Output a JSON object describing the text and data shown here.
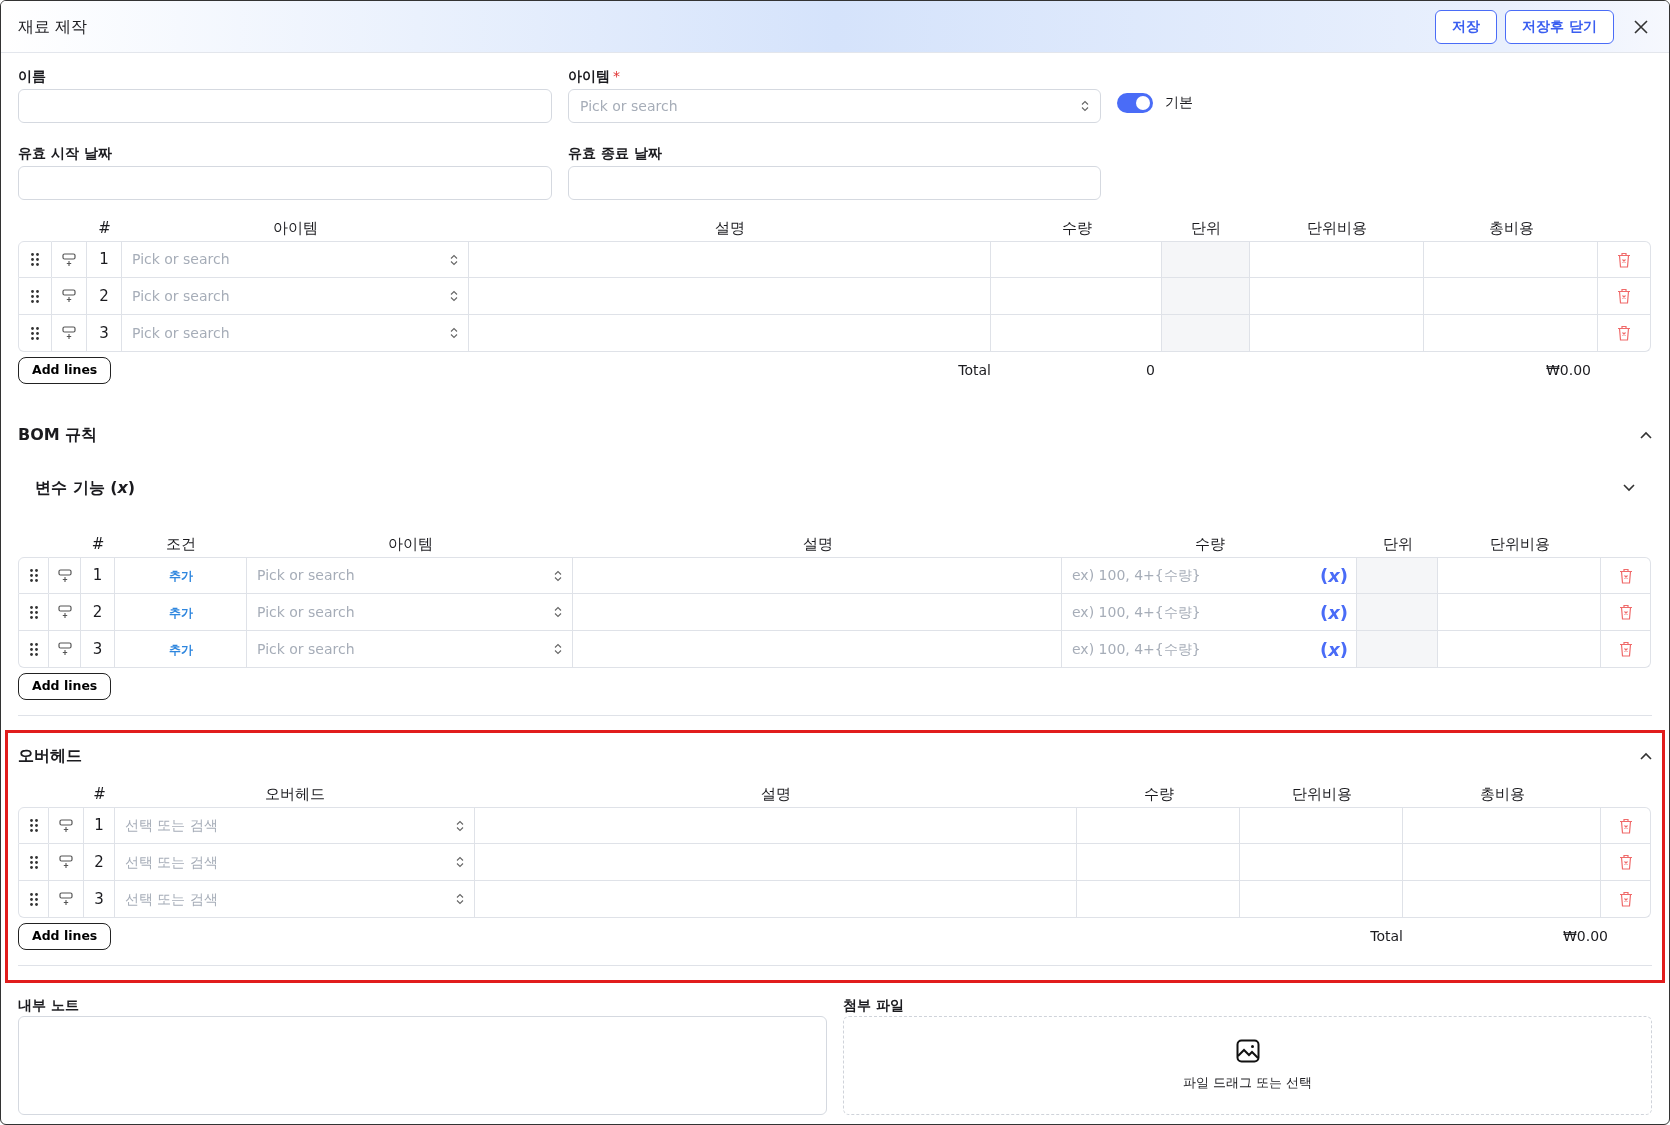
{
  "header": {
    "title": "재료 제작",
    "buttons": [
      "저장",
      "저장후 닫기"
    ]
  },
  "fields": [
    {
      "label": "이름",
      "kind": "text"
    },
    {
      "label": "아이템",
      "required_mark": "*",
      "kind": "select",
      "placeholder": "Pick or search"
    },
    {
      "label": "유효 시작 날짜",
      "kind": "text"
    },
    {
      "label": "유효 종료 날짜",
      "kind": "text"
    }
  ],
  "default_toggle": {
    "label": "기본",
    "on": true
  },
  "materials": {
    "columns": [
      "#",
      "아이템",
      "설명",
      "수량",
      "단위",
      "단위비용",
      "총비용"
    ],
    "rows": [
      {
        "number": "1",
        "item_placeholder": "Pick or search"
      },
      {
        "number": "2",
        "item_placeholder": "Pick or search"
      },
      {
        "number": "3",
        "item_placeholder": "Pick or search"
      }
    ],
    "add_button": "Add lines",
    "total_label": "Total",
    "total_quantity": "0",
    "total_cost": "₩0.00"
  },
  "bom_rules": {
    "title": "BOM 규칙",
    "expanded": true,
    "variable_feature": {
      "title": "변수 기능 (*x*)",
      "expanded": false
    },
    "columns": [
      "#",
      "조건",
      "아이템",
      "설명",
      "수량",
      "단위",
      "단위비용"
    ],
    "rows": [
      {
        "number": "1",
        "condition": "추가",
        "item_placeholder": "Pick or search",
        "quantity_placeholder": "ex) 100, 4+{수량}",
        "variable_button": "(*x*)"
      },
      {
        "number": "2",
        "condition": "추가",
        "item_placeholder": "Pick or search",
        "quantity_placeholder": "ex) 100, 4+{수량}",
        "variable_button": "(*x*)"
      },
      {
        "number": "3",
        "condition": "추가",
        "item_placeholder": "Pick or search",
        "quantity_placeholder": "ex) 100, 4+{수량}",
        "variable_button": "(*x*)"
      }
    ],
    "add_button": "Add lines"
  },
  "overhead": {
    "title": "오버헤드",
    "expanded": true,
    "highlighted": true,
    "columns": [
      "#",
      "오버헤드",
      "설명",
      "수량",
      "단위비용",
      "총비용"
    ],
    "rows": [
      {
        "number": "1",
        "item_placeholder": "선택 또는 검색"
      },
      {
        "number": "2",
        "item_placeholder": "선택 또는 검색"
      },
      {
        "number": "3",
        "item_placeholder": "선택 또는 검색"
      }
    ],
    "add_button": "Add lines",
    "total_label": "Total",
    "total_cost": "₩0.00"
  },
  "notes": {
    "label": "내부 노트"
  },
  "attachments": {
    "label": "첨부 파일",
    "prompt": "파일 드래그 또는 선택"
  }
}
